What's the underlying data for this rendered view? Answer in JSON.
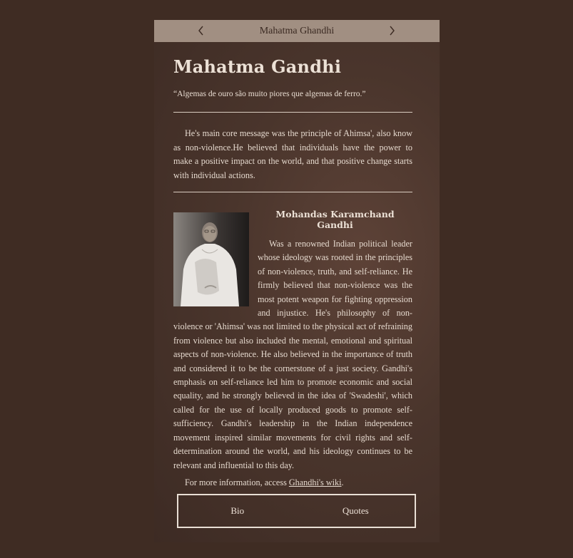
{
  "nav": {
    "title": "Mahatma Ghandhi",
    "prev_icon": "chevron-left-icon",
    "next_icon": "chevron-right-icon"
  },
  "page": {
    "title": "Mahatma Gandhi",
    "quote": "“Algemas de ouro são muito piores que algemas de ferro.”",
    "intro": "He's main core message was the principle of Ahimsa', also know as non-violence.He believed that individuals have the power to make a positive impact on the world, and that positive change starts with individual actions."
  },
  "bio": {
    "name": "Mohandas Karamchand Gandhi",
    "text": "Was a renowned Indian political leader whose ideology was rooted in the principles of non-violence, truth, and self-reliance. He firmly believed that non-violence was the most potent weapon for fighting oppression and injustice. He's philosophy of non-violence or 'Ahimsa' was not limited to the physical act of refraining from violence but also included the mental, emotional and spiritual aspects of non-violence. He also believed in the importance of truth and considered it to be the cornerstone of a just society. Gandhi's emphasis on self-reliance led him to promote economic and social equality, and he strongly believed in the idea of 'Swadeshi', which called for the use of locally produced goods to promote self-sufficiency. Gandhi's leadership in the Indian independence movement inspired similar movements for civil rights and self-determination around the world, and his ideology continues to be relevant and influential to this day.",
    "more_prefix": "For more information, access ",
    "more_link": "Ghandhi's wiki",
    "more_suffix": "."
  },
  "tabs": {
    "bio": "Bio",
    "quotes": "Quotes"
  },
  "colors": {
    "background": "#3f2c23",
    "nav_bar": "#a18f82",
    "text": "#e6dacf"
  }
}
